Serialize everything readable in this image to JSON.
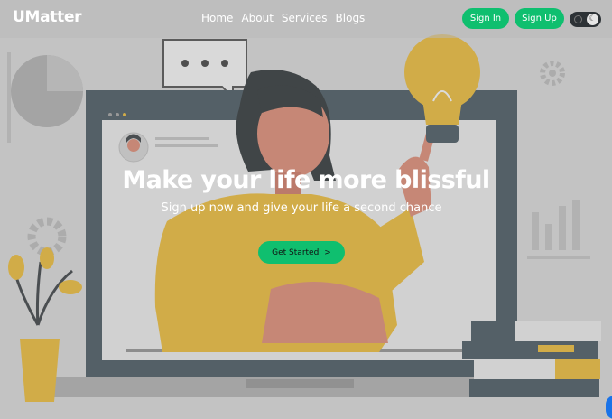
{
  "brand": {
    "name": "UMatter"
  },
  "nav": {
    "links": [
      "Home",
      "About",
      "Services",
      "Blogs"
    ],
    "sign_in": "Sign In",
    "sign_up": "Sign Up"
  },
  "theme_toggle": {
    "state": "dark",
    "icon_off": "sun-icon",
    "icon_on": "moon-icon"
  },
  "hero": {
    "title": "Make your life more blissful",
    "subtitle": "Sign up now and give your life a second chance",
    "cta": "Get Started",
    "cta_icon": "chevron-right-icon"
  },
  "colors": {
    "accent": "#0fbf6f",
    "illustration_yellow": "#e8b52a",
    "monitor": "#3b4b55",
    "skin": "#d9826a"
  }
}
